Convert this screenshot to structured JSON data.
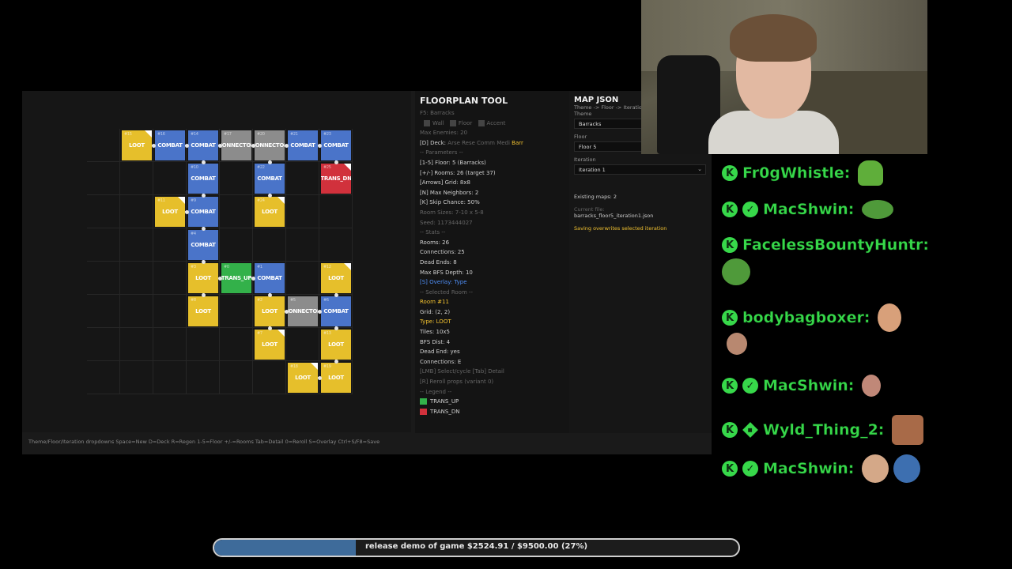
{
  "tool": {
    "floorplan": {
      "title": "FLOORPLAN TOOL",
      "subtitle": "F5: Barracks",
      "checks": [
        "Wall",
        "Floor",
        "Accent"
      ],
      "max_enemies": "Max Enemies: 20",
      "deck_label": "[D] Deck:",
      "deck_options": "Arse Rese Comm Medi",
      "deck_selected": "Barr",
      "params_header": "-- Parameters --",
      "params": [
        "[1-5] Floor: 5 (Barracks)",
        "[+/-] Rooms: 26 (target 37)",
        "[Arrows] Grid: 8x8",
        "[N] Max Neighbors: 2",
        "[K] Skip Chance: 50%",
        "Room Sizes: 7-10 x 5-8",
        "Seed: 1173444027"
      ],
      "stats_header": "-- Stats --",
      "stats": [
        "Rooms: 26",
        "Connections: 25",
        "Dead Ends: 8",
        "Max BFS Depth: 10"
      ],
      "overlay": "[S] Overlay: Type",
      "selected_header": "-- Selected Room --",
      "selected_room": "Room #11",
      "selected_grid": "Grid: (2, 2)",
      "selected_type": "Type: LOOT",
      "selected_details": [
        "Tiles: 10x5",
        "BFS Dist: 4",
        "Dead End: yes",
        "Connections: E"
      ],
      "hints": [
        "[LMB] Select/cycle  [Tab] Detail",
        "[R] Reroll props (variant 0)"
      ],
      "legend_header": "-- Legend --",
      "legend": [
        {
          "label": "TRANS_UP",
          "color": "#33b14a"
        },
        {
          "label": "TRANS_DN",
          "color": "#d1313c"
        }
      ]
    },
    "json_panel": {
      "title": "MAP JSON",
      "breadcrumb": "Theme -> Floor -> Iteration",
      "theme_label": "Theme",
      "theme_value": "Barracks",
      "floor_label": "Floor",
      "floor_value": "Floor 5",
      "iteration_label": "Iteration",
      "iteration_value": "Iteration 1",
      "existing": "Existing maps: 2",
      "current_label": "Current file:",
      "current_file": "barracks_floor5_iteration1.json",
      "saving_note": "Saving overwrites selected iteration"
    },
    "shortcuts": "Theme/Floor/Iteration dropdowns  Space=New  D=Deck  R=Regen  1-5=Floor  +/-=Rooms  Tab=Detail  0=Reroll  S=Overlay  Ctrl+S/F8=Save",
    "room_colors": {
      "LOOT": "#e6bf2b",
      "COMBAT": "#4a74c9",
      "CONNECTOR": "#8c8c8c",
      "TRANS_UP": "#33b14a",
      "TRANS_DN": "#d1313c"
    },
    "rooms": [
      {
        "id": "#15",
        "type": "LOOT",
        "label": "LOOT",
        "col": 1,
        "row": 0,
        "corner": true
      },
      {
        "id": "#16",
        "type": "COMBAT",
        "label": "COMBAT",
        "col": 2,
        "row": 0
      },
      {
        "id": "#14",
        "type": "COMBAT",
        "label": "COMBAT",
        "col": 3,
        "row": 0
      },
      {
        "id": "#17",
        "type": "CONNECTOR",
        "label": "CONNECTOR",
        "col": 4,
        "row": 0
      },
      {
        "id": "#20",
        "type": "CONNECTOR",
        "label": "CONNECTOR",
        "col": 5,
        "row": 0
      },
      {
        "id": "#21",
        "type": "COMBAT",
        "label": "COMBAT",
        "col": 6,
        "row": 0
      },
      {
        "id": "#23",
        "type": "COMBAT",
        "label": "COMBAT",
        "col": 7,
        "row": 0
      },
      {
        "id": "#10",
        "type": "COMBAT",
        "label": "COMBAT",
        "col": 3,
        "row": 1
      },
      {
        "id": "#22",
        "type": "COMBAT",
        "label": "COMBAT",
        "col": 5,
        "row": 1
      },
      {
        "id": "#25",
        "type": "TRANS_DN",
        "label": "TRANS_DN",
        "col": 7,
        "row": 1,
        "corner": true
      },
      {
        "id": "#11",
        "type": "LOOT",
        "label": "LOOT",
        "col": 2,
        "row": 2,
        "corner": true
      },
      {
        "id": "#9",
        "type": "COMBAT",
        "label": "COMBAT",
        "col": 3,
        "row": 2
      },
      {
        "id": "#24",
        "type": "LOOT",
        "label": "LOOT",
        "col": 5,
        "row": 2,
        "corner": true
      },
      {
        "id": "#4",
        "type": "COMBAT",
        "label": "COMBAT",
        "col": 3,
        "row": 3
      },
      {
        "id": "#3",
        "type": "LOOT",
        "label": "LOOT",
        "col": 3,
        "row": 4
      },
      {
        "id": "#0",
        "type": "TRANS_UP",
        "label": "TRANS_UP",
        "col": 4,
        "row": 4
      },
      {
        "id": "#1",
        "type": "COMBAT",
        "label": "COMBAT",
        "col": 5,
        "row": 4
      },
      {
        "id": "#12",
        "type": "LOOT",
        "label": "LOOT",
        "col": 7,
        "row": 4,
        "corner": true
      },
      {
        "id": "#8",
        "type": "LOOT",
        "label": "LOOT",
        "col": 3,
        "row": 5
      },
      {
        "id": "#2",
        "type": "LOOT",
        "label": "LOOT",
        "col": 5,
        "row": 5
      },
      {
        "id": "#5",
        "type": "CONNECTOR",
        "label": "CONNECTOR",
        "col": 6,
        "row": 5
      },
      {
        "id": "#6",
        "type": "COMBAT",
        "label": "COMBAT",
        "col": 7,
        "row": 5
      },
      {
        "id": "#7",
        "type": "LOOT",
        "label": "LOOT",
        "col": 5,
        "row": 6,
        "corner": true
      },
      {
        "id": "#13",
        "type": "LOOT",
        "label": "LOOT",
        "col": 7,
        "row": 6
      },
      {
        "id": "#18",
        "type": "LOOT",
        "label": "LOOT",
        "col": 6,
        "row": 7,
        "corner": true
      },
      {
        "id": "#19",
        "type": "LOOT",
        "label": "LOOT",
        "col": 7,
        "row": 7
      }
    ],
    "connections": [
      [
        1,
        0,
        2,
        0
      ],
      [
        2,
        0,
        3,
        0
      ],
      [
        3,
        0,
        4,
        0
      ],
      [
        4,
        0,
        5,
        0
      ],
      [
        5,
        0,
        6,
        0
      ],
      [
        6,
        0,
        7,
        0
      ],
      [
        3,
        0,
        3,
        1
      ],
      [
        5,
        0,
        5,
        1
      ],
      [
        7,
        0,
        7,
        1
      ],
      [
        3,
        1,
        3,
        2
      ],
      [
        2,
        2,
        3,
        2
      ],
      [
        5,
        1,
        5,
        2
      ],
      [
        3,
        2,
        3,
        3
      ],
      [
        3,
        3,
        3,
        4
      ],
      [
        3,
        4,
        4,
        4
      ],
      [
        4,
        4,
        5,
        4
      ],
      [
        3,
        4,
        3,
        5
      ],
      [
        5,
        4,
        5,
        5
      ],
      [
        5,
        5,
        6,
        5
      ],
      [
        6,
        5,
        7,
        5
      ],
      [
        7,
        4,
        7,
        5
      ],
      [
        5,
        5,
        5,
        6
      ],
      [
        7,
        5,
        7,
        6
      ],
      [
        7,
        6,
        7,
        7
      ],
      [
        6,
        7,
        7,
        7
      ]
    ]
  },
  "chat": {
    "messages": [
      {
        "user": "Fr0gWhistle:",
        "verified": false,
        "emote": "frog"
      },
      {
        "user": "MacShwin:",
        "verified": true,
        "emote": "pepe"
      },
      {
        "user": "FacelessBountyHuntr:",
        "verified": false,
        "emote": "pepe-below"
      },
      {
        "user": "bodybagboxer:",
        "verified": false,
        "emote": "face"
      },
      {
        "user": "MacShwin:",
        "verified": true,
        "emote": "face"
      },
      {
        "user": "Wyld_Thing_2:",
        "verified": false,
        "diamond": true,
        "emote": "face"
      },
      {
        "user": "MacShwin:",
        "verified": true,
        "emote": "face2"
      }
    ]
  },
  "goal": {
    "text": "release demo of game $2524.91 / $9500.00 (27%)",
    "progress": 0.27,
    "fill_color": "#3e6b9a"
  }
}
